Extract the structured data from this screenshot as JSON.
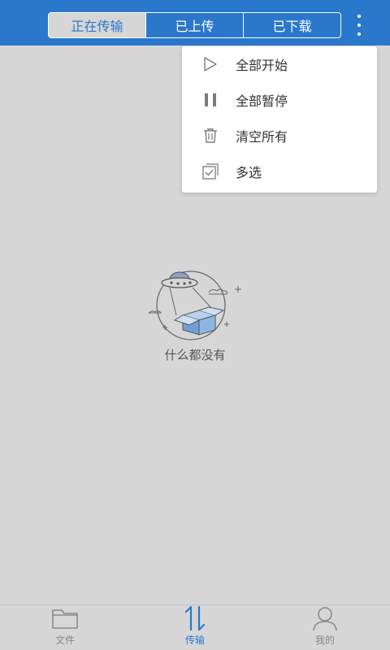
{
  "colors": {
    "accent": "#2a78cc",
    "background": "#d6d6d6",
    "menu_bg": "#ffffff"
  },
  "header": {
    "tabs": [
      {
        "label": "正在传输",
        "active": true
      },
      {
        "label": "已上传",
        "active": false
      },
      {
        "label": "已下载",
        "active": false
      }
    ],
    "more_icon": "more-vertical-icon"
  },
  "menu": {
    "items": [
      {
        "label": "全部开始",
        "icon": "play-icon"
      },
      {
        "label": "全部暂停",
        "icon": "pause-icon"
      },
      {
        "label": "清空所有",
        "icon": "trash-icon"
      },
      {
        "label": "多选",
        "icon": "multi-select-icon"
      }
    ]
  },
  "empty_state": {
    "text": "什么都没有",
    "illustration": "ufo-box-illustration"
  },
  "bottom_nav": {
    "items": [
      {
        "label": "文件",
        "icon": "folder-icon",
        "active": false
      },
      {
        "label": "传输",
        "icon": "transfer-icon",
        "active": true
      },
      {
        "label": "我的",
        "icon": "person-icon",
        "active": false
      }
    ]
  }
}
